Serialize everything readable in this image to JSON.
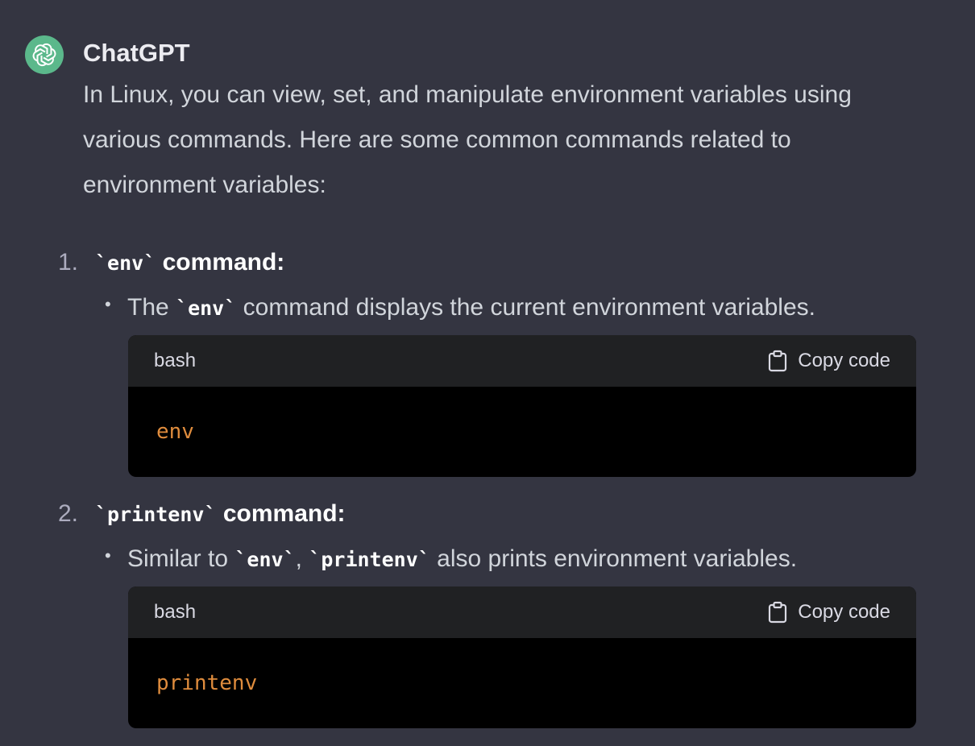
{
  "message": {
    "author": "ChatGPT",
    "intro": "In Linux, you can view, set, and manipulate environment variables using various commands. Here are some common commands related to environment variables:"
  },
  "items": [
    {
      "number": "1.",
      "code": "`env`",
      "title": " command:",
      "bullet": {
        "prefix": "The ",
        "code": "`env`",
        "suffix": " command displays the current environment variables."
      },
      "codeblock": {
        "language": "bash",
        "copy_label": "Copy code",
        "code": "env"
      }
    },
    {
      "number": "2.",
      "code": "`printenv`",
      "title": " command:",
      "bullet": {
        "prefix": "Similar to ",
        "code1": "`env`",
        "mid": ", ",
        "code2": "`printenv`",
        "suffix": " also prints environment variables."
      },
      "codeblock": {
        "language": "bash",
        "copy_label": "Copy code",
        "code": "printenv"
      }
    }
  ],
  "icons": {
    "avatar": "openai-logo-icon",
    "copy": "clipboard-icon"
  },
  "colors": {
    "background": "#343541",
    "avatar_bg": "#5bb88b",
    "code_header_bg": "#202123",
    "code_body_bg": "#000000",
    "code_text": "#df8c3d"
  }
}
